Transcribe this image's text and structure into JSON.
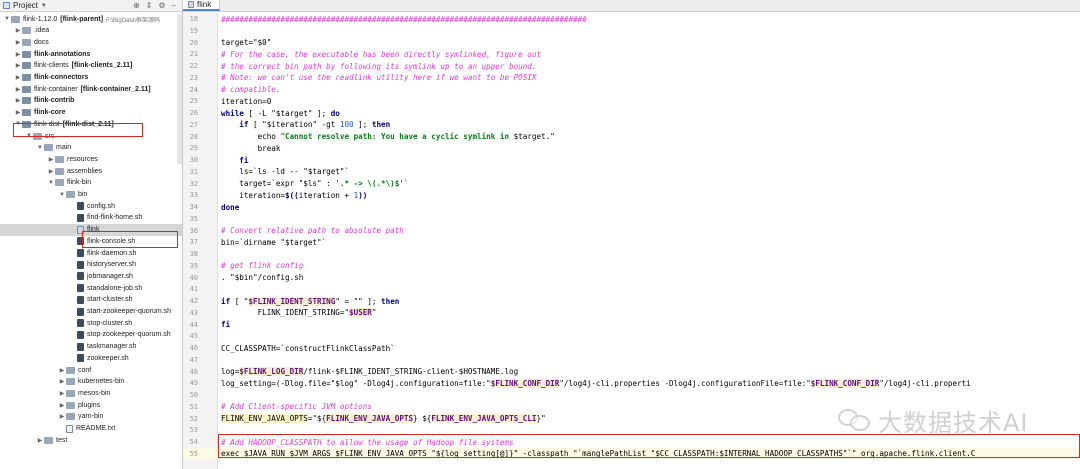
{
  "panel": {
    "title": "Project",
    "tools": [
      "⊕",
      "⇕",
      "⚙",
      "–"
    ],
    "tree": [
      {
        "label": "flink-1.12.0",
        "bold_suffix": "[flink-parent]",
        "path": "F:\\BigData\\框架源码",
        "indent": 0,
        "type": "folder",
        "arrow": "open"
      },
      {
        "label": ".idea",
        "indent": 1,
        "type": "folder",
        "arrow": "closed"
      },
      {
        "label": "docs",
        "indent": 1,
        "type": "folder",
        "arrow": "closed"
      },
      {
        "label": "flink-annotations",
        "indent": 1,
        "type": "module",
        "arrow": "closed",
        "bold": true
      },
      {
        "label": "flink-clients",
        "bold_suffix": "[flink-clients_2.11]",
        "indent": 1,
        "type": "module",
        "arrow": "closed"
      },
      {
        "label": "flink-connectors",
        "indent": 1,
        "type": "module",
        "arrow": "closed",
        "bold": true
      },
      {
        "label": "flink-container",
        "bold_suffix": "[flink-container_2.11]",
        "indent": 1,
        "type": "module",
        "arrow": "closed"
      },
      {
        "label": "flink-contrib",
        "indent": 1,
        "type": "module",
        "arrow": "closed",
        "bold": true
      },
      {
        "label": "flink-core",
        "indent": 1,
        "type": "module",
        "arrow": "closed",
        "bold": true
      },
      {
        "label": "flink-dist",
        "bold_suffix": "[flink-dist_2.11]",
        "indent": 1,
        "type": "module",
        "arrow": "open"
      },
      {
        "label": "src",
        "indent": 2,
        "type": "folder",
        "arrow": "open"
      },
      {
        "label": "main",
        "indent": 3,
        "type": "folder",
        "arrow": "open"
      },
      {
        "label": "resources",
        "indent": 4,
        "type": "folder",
        "arrow": "closed"
      },
      {
        "label": "assemblies",
        "indent": 4,
        "type": "folder",
        "arrow": "closed"
      },
      {
        "label": "flink-bin",
        "indent": 4,
        "type": "folder",
        "arrow": "open"
      },
      {
        "label": "bin",
        "indent": 5,
        "type": "folder",
        "arrow": "open"
      },
      {
        "label": "config.sh",
        "indent": 6,
        "type": "sh",
        "arrow": "none"
      },
      {
        "label": "find-flink-home.sh",
        "indent": 6,
        "type": "sh",
        "arrow": "none"
      },
      {
        "label": "flink",
        "indent": 6,
        "type": "file",
        "arrow": "none",
        "selected": true
      },
      {
        "label": "flink-console.sh",
        "indent": 6,
        "type": "sh",
        "arrow": "none"
      },
      {
        "label": "flink-daemon.sh",
        "indent": 6,
        "type": "sh",
        "arrow": "none"
      },
      {
        "label": "historyserver.sh",
        "indent": 6,
        "type": "sh",
        "arrow": "none"
      },
      {
        "label": "jobmanager.sh",
        "indent": 6,
        "type": "sh",
        "arrow": "none"
      },
      {
        "label": "standalone-job.sh",
        "indent": 6,
        "type": "sh",
        "arrow": "none"
      },
      {
        "label": "start-cluster.sh",
        "indent": 6,
        "type": "sh",
        "arrow": "none"
      },
      {
        "label": "start-zookeeper-quorum.sh",
        "indent": 6,
        "type": "sh",
        "arrow": "none"
      },
      {
        "label": "stop-cluster.sh",
        "indent": 6,
        "type": "sh",
        "arrow": "none"
      },
      {
        "label": "stop-zookeeper-quorum.sh",
        "indent": 6,
        "type": "sh",
        "arrow": "none"
      },
      {
        "label": "taskmanager.sh",
        "indent": 6,
        "type": "sh",
        "arrow": "none"
      },
      {
        "label": "zookeeper.sh",
        "indent": 6,
        "type": "sh",
        "arrow": "none"
      },
      {
        "label": "conf",
        "indent": 5,
        "type": "folder",
        "arrow": "closed"
      },
      {
        "label": "kubernetes-bin",
        "indent": 5,
        "type": "folder",
        "arrow": "closed"
      },
      {
        "label": "mesos-bin",
        "indent": 5,
        "type": "folder",
        "arrow": "closed"
      },
      {
        "label": "plugins",
        "indent": 5,
        "type": "folder",
        "arrow": "closed"
      },
      {
        "label": "yarn-bin",
        "indent": 5,
        "type": "folder",
        "arrow": "closed"
      },
      {
        "label": "README.txt",
        "indent": 5,
        "type": "txt",
        "arrow": "none"
      },
      {
        "label": "test",
        "indent": 3,
        "type": "folder",
        "arrow": "closed"
      }
    ]
  },
  "editor": {
    "tab_label": "flink",
    "lines": [
      {
        "n": 18,
        "segs": [
          [
            "c",
            "################################################################################"
          ]
        ]
      },
      {
        "n": 19,
        "segs": []
      },
      {
        "n": 20,
        "segs": [
          [
            "",
            "target=\"$0\""
          ]
        ]
      },
      {
        "n": 21,
        "segs": [
          [
            "c",
            "# For the case, the executable has been directly symlinked, figure out"
          ]
        ]
      },
      {
        "n": 22,
        "segs": [
          [
            "c",
            "# the correct bin path by following its symlink up to an upper bound."
          ]
        ]
      },
      {
        "n": 23,
        "segs": [
          [
            "c",
            "# Note: we can't use the readlink utility here if we want to be POSIX"
          ]
        ]
      },
      {
        "n": 24,
        "segs": [
          [
            "c",
            "# compatible."
          ]
        ]
      },
      {
        "n": 25,
        "segs": [
          [
            "",
            "iteration=0"
          ]
        ]
      },
      {
        "n": 26,
        "segs": [
          [
            "k",
            "while"
          ],
          [
            "",
            " [ -L \"$target\" ]; "
          ],
          [
            "k",
            "do"
          ]
        ]
      },
      {
        "n": 27,
        "segs": [
          [
            "",
            "    "
          ],
          [
            "k",
            "if"
          ],
          [
            "",
            " [ \"$iteration\" -gt "
          ],
          [
            "n",
            "100"
          ],
          [
            "",
            " ]; "
          ],
          [
            "k",
            "then"
          ]
        ]
      },
      {
        "n": 28,
        "segs": [
          [
            "",
            "        echo "
          ],
          [
            "s",
            "\"Cannot resolve path: You have a cyclic symlink in "
          ],
          [
            "",
            "$target"
          ],
          [
            "s",
            ".\""
          ]
        ]
      },
      {
        "n": 29,
        "segs": [
          [
            "",
            "        break"
          ]
        ]
      },
      {
        "n": 30,
        "segs": [
          [
            "",
            "    "
          ],
          [
            "k",
            "fi"
          ]
        ]
      },
      {
        "n": 31,
        "segs": [
          [
            "",
            "    ls=`ls -ld -- \"$target\"`"
          ]
        ]
      },
      {
        "n": 32,
        "segs": [
          [
            "",
            "    target=`expr \"$ls\" : "
          ],
          [
            "s",
            "'.* -> \\(.*\\)$'"
          ],
          [
            "",
            "`"
          ]
        ]
      },
      {
        "n": 33,
        "segs": [
          [
            "",
            "    iteration="
          ],
          [
            "k",
            "$(("
          ],
          [
            "",
            "iteration + "
          ],
          [
            "n",
            "1"
          ],
          [
            "k",
            "))"
          ]
        ]
      },
      {
        "n": 34,
        "segs": [
          [
            "k",
            "done"
          ]
        ]
      },
      {
        "n": 35,
        "segs": []
      },
      {
        "n": 36,
        "segs": [
          [
            "c",
            "# Convert relative path to absolute path"
          ]
        ]
      },
      {
        "n": 37,
        "segs": [
          [
            "",
            "bin=`dirname \"$target\"`"
          ]
        ]
      },
      {
        "n": 38,
        "segs": []
      },
      {
        "n": 39,
        "segs": [
          [
            "c",
            "# get flink config"
          ]
        ]
      },
      {
        "n": 40,
        "segs": [
          [
            "",
            ". \"$bin\"/config.sh"
          ]
        ]
      },
      {
        "n": 41,
        "segs": []
      },
      {
        "n": 42,
        "segs": [
          [
            "k",
            "if"
          ],
          [
            "",
            " [ \""
          ],
          [
            "vb",
            "$FLINK_IDENT_STRING"
          ],
          [
            "",
            "\" = \"\" ]; "
          ],
          [
            "k",
            "then"
          ]
        ]
      },
      {
        "n": 43,
        "segs": [
          [
            "",
            "        FLINK_IDENT_STRING=\""
          ],
          [
            "vb",
            "$USER"
          ],
          [
            "",
            "\""
          ]
        ]
      },
      {
        "n": 44,
        "segs": [
          [
            "k",
            "fi"
          ]
        ]
      },
      {
        "n": 45,
        "segs": []
      },
      {
        "n": 46,
        "segs": [
          [
            "",
            "CC_CLASSPATH=`constructFlinkClassPath`"
          ]
        ]
      },
      {
        "n": 47,
        "segs": []
      },
      {
        "n": 48,
        "segs": [
          [
            "",
            "log="
          ],
          [
            "vb",
            "$FLINK_LOG_DIR"
          ],
          [
            "",
            "/flink-$FLINK_IDENT_STRING-client-$HOSTNAME.log"
          ]
        ]
      },
      {
        "n": 49,
        "segs": [
          [
            "",
            "log_setting=(-Dlog.file=\"$log\" -Dlog4j.configuration=file:\""
          ],
          [
            "vb",
            "$FLINK_CONF_DIR"
          ],
          [
            "",
            "\"/log4j-cli.properties -Dlog4j.configurationFile=file:\""
          ],
          [
            "vb",
            "$FLINK_CONF_DIR"
          ],
          [
            "",
            "\"/log4j-cli.properti"
          ]
        ]
      },
      {
        "n": 50,
        "segs": []
      },
      {
        "n": 51,
        "segs": [
          [
            "c",
            "# Add Client-specific JVM options"
          ]
        ]
      },
      {
        "n": 52,
        "segs": [
          [
            "y",
            "FLINK_ENV_JAVA_OPTS"
          ],
          [
            "",
            "=\"${"
          ],
          [
            "vb",
            "FLINK_ENV_JAVA_OPTS"
          ],
          [
            "",
            "} ${"
          ],
          [
            "vb",
            "FLINK_ENV_JAVA_OPTS_CLI"
          ],
          [
            "",
            "}\""
          ]
        ]
      },
      {
        "n": 53,
        "segs": []
      },
      {
        "n": 54,
        "segs": [
          [
            "c",
            "# Add HADOOP_CLASSPATH to allow the usage of Hadoop file systems"
          ]
        ]
      },
      {
        "n": 55,
        "segs": [
          [
            "",
            "exec $JAVA_RUN $JVM_ARGS $FLINK_ENV_JAVA_OPTS \"${log_setting[@]}\" -classpath \"`manglePathList \"$CC_CLASSPATH:$INTERNAL_HADOOP_CLASSPATHS\"`\" org.apache.flink.client.C"
          ]
        ],
        "current": true
      }
    ]
  },
  "watermark": {
    "text": "大数据技术AI"
  }
}
